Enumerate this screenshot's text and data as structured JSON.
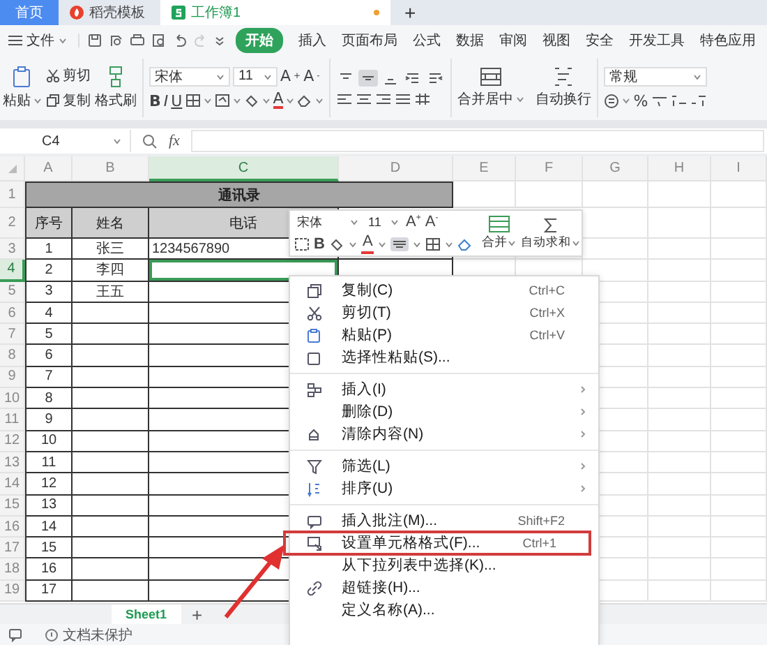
{
  "tabs": [
    {
      "label": "首页",
      "kind": "home",
      "selected": false
    },
    {
      "label": "稻壳模板",
      "kind": "docer",
      "selected": false
    },
    {
      "label": "工作簿1",
      "kind": "sheet",
      "selected": true,
      "unsaved": true
    }
  ],
  "new_tab": "+",
  "menu": {
    "file": "文件",
    "items": [
      {
        "label": "开始",
        "selected": true
      },
      {
        "label": "插入",
        "selected": false
      },
      {
        "label": "页面布局",
        "selected": false
      },
      {
        "label": "公式",
        "selected": false
      },
      {
        "label": "数据",
        "selected": false
      },
      {
        "label": "审阅",
        "selected": false
      },
      {
        "label": "视图",
        "selected": false
      },
      {
        "label": "安全",
        "selected": false
      },
      {
        "label": "开发工具",
        "selected": false
      },
      {
        "label": "特色应用",
        "selected": false
      }
    ]
  },
  "ribbon": {
    "paste": "粘贴",
    "cut": "剪切",
    "copy": "复制",
    "format_painter": "格式刷",
    "font": "宋体",
    "font_size": "11",
    "grow": "A$^{+}$",
    "shrink": "A$^{-}$",
    "styles": [
      "B",
      "I",
      "U"
    ],
    "font_color": "A",
    "align": [
      {
        "selected": false
      },
      {
        "selected": true
      },
      {
        "selected": false
      },
      {
        "selected": false
      },
      {
        "selected": false
      }
    ],
    "merge": "合并居中",
    "wrap": "自动换行",
    "number_format": "常规",
    "percent": "%"
  },
  "formula_bar": {
    "cell": "C4",
    "fx": "fx"
  },
  "sheet": {
    "columns": [
      {
        "label": "A",
        "selected": false
      },
      {
        "label": "B",
        "selected": false
      },
      {
        "label": "C",
        "selected": true
      },
      {
        "label": "D",
        "selected": false
      },
      {
        "label": "E",
        "selected": false
      },
      {
        "label": "F",
        "selected": false
      },
      {
        "label": "G",
        "selected": false
      },
      {
        "label": "H",
        "selected": false
      },
      {
        "label": "I",
        "selected": false
      }
    ],
    "rows": [
      {
        "label": "1",
        "selected": false
      },
      {
        "label": "2",
        "selected": false
      },
      {
        "label": "3",
        "selected": false
      },
      {
        "label": "4",
        "selected": true
      },
      {
        "label": "5",
        "selected": false
      },
      {
        "label": "6",
        "selected": false
      },
      {
        "label": "7",
        "selected": false
      },
      {
        "label": "8",
        "selected": false
      },
      {
        "label": "9",
        "selected": false
      },
      {
        "label": "10",
        "selected": false
      },
      {
        "label": "11",
        "selected": false
      },
      {
        "label": "12",
        "selected": false
      },
      {
        "label": "13",
        "selected": false
      },
      {
        "label": "14",
        "selected": false
      },
      {
        "label": "15",
        "selected": false
      },
      {
        "label": "16",
        "selected": false
      },
      {
        "label": "17",
        "selected": false
      },
      {
        "label": "18",
        "selected": false
      },
      {
        "label": "19",
        "selected": false
      }
    ],
    "title": "通讯录",
    "headers": [
      "序号",
      "姓名",
      "电话"
    ],
    "records": [
      {
        "no": "1",
        "name": "张三",
        "phone": "1234567890"
      },
      {
        "no": "2",
        "name": "李四"
      },
      {
        "no": "3",
        "name": "王五"
      },
      {
        "no": "4"
      },
      {
        "no": "5"
      },
      {
        "no": "6"
      },
      {
        "no": "7"
      },
      {
        "no": "8"
      },
      {
        "no": "9"
      },
      {
        "no": "10"
      },
      {
        "no": "11"
      },
      {
        "no": "12"
      },
      {
        "no": "13"
      },
      {
        "no": "14"
      },
      {
        "no": "15"
      },
      {
        "no": "16"
      },
      {
        "no": "17"
      }
    ]
  },
  "mini_toolbar": {
    "font": "宋体",
    "font_size": "11",
    "grow": "A$^{+}$",
    "shrink": "A$^{-}$",
    "bold": "B",
    "font_color": "A",
    "merge": "合并",
    "autosum": "自动求和"
  },
  "context_menu": {
    "items": [
      {
        "kind": "item",
        "label": "复制(C)",
        "shortcut": "Ctrl+C",
        "submenu": false,
        "highlighted": false
      },
      {
        "kind": "item",
        "label": "剪切(T)",
        "shortcut": "Ctrl+X",
        "submenu": false,
        "highlighted": false
      },
      {
        "kind": "item",
        "label": "粘贴(P)",
        "shortcut": "Ctrl+V",
        "submenu": false,
        "highlighted": false
      },
      {
        "kind": "item",
        "label": "选择性粘贴(S)...",
        "submenu": false,
        "highlighted": false
      },
      {
        "kind": "separator"
      },
      {
        "kind": "item",
        "label": "插入(I)",
        "submenu": true,
        "highlighted": false
      },
      {
        "kind": "item",
        "label": "删除(D)",
        "submenu": true,
        "highlighted": false
      },
      {
        "kind": "item",
        "label": "清除内容(N)",
        "submenu": true,
        "highlighted": false
      },
      {
        "kind": "separator"
      },
      {
        "kind": "item",
        "label": "筛选(L)",
        "submenu": true,
        "highlighted": false
      },
      {
        "kind": "item",
        "label": "排序(U)",
        "submenu": true,
        "highlighted": false
      },
      {
        "kind": "separator"
      },
      {
        "kind": "item",
        "label": "插入批注(M)...",
        "shortcut": "Shift+F2",
        "submenu": false,
        "highlighted": false
      },
      {
        "kind": "item",
        "label": "设置单元格格式(F)...",
        "shortcut": "Ctrl+1",
        "submenu": false,
        "highlighted": true
      },
      {
        "kind": "item",
        "label": "从下拉列表中选择(K)...",
        "submenu": false,
        "highlighted": false
      },
      {
        "kind": "item",
        "label": "超链接(H)...",
        "submenu": false,
        "highlighted": false
      },
      {
        "kind": "item",
        "label": "定义名称(A)...",
        "submenu": false,
        "highlighted": false
      }
    ]
  },
  "sheet_tabs": [
    {
      "label": "Sheet1",
      "selected": true
    }
  ],
  "add_sheet": "+",
  "status": "文档未保护"
}
